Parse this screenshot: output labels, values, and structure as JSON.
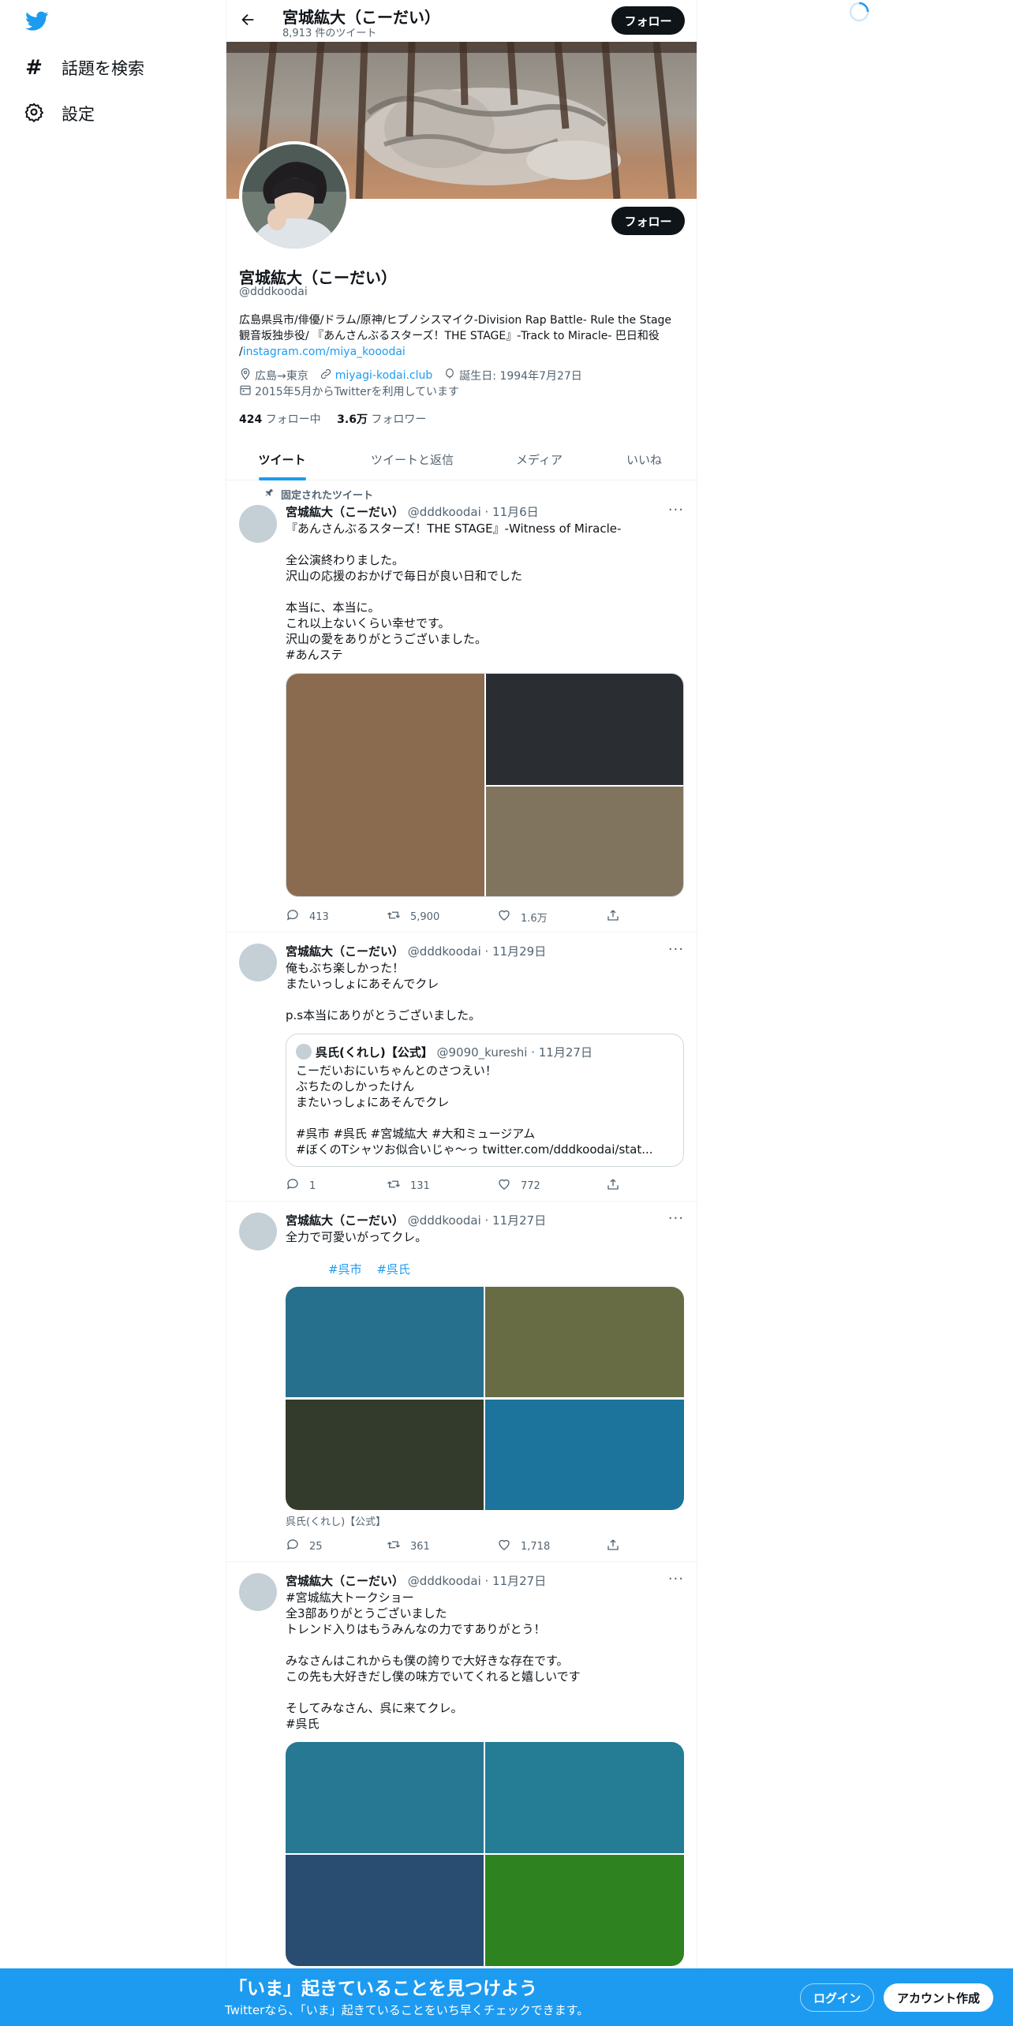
{
  "nav": {
    "items": [
      {
        "label": "話題を検索",
        "icon": "hashtag-icon"
      },
      {
        "label": "設定",
        "icon": "gear-icon"
      }
    ]
  },
  "header": {
    "title": "宮城紘大（こーだい）",
    "subtitle": "8,913 件のツイート",
    "follow_label": "フォロー"
  },
  "profile": {
    "name": "宮城紘大（こーだい）",
    "handle": "@dddkoodai",
    "follow_label": "フォロー",
    "bio_line1": "広島県呉市/俳優/ドラム/原神/ヒプノシスマイク-Division Rap Battle- Rule the Stage",
    "bio_line2": "観音坂独歩役/ 『あんさんぶるスターズ！THE STAGE』-Track to Miracle- 巴日和役",
    "bio_line3_prefix": "/",
    "bio_link": "instagram.com/miya_kooodai",
    "location": "広島→東京",
    "website": "miyagi-kodai.club",
    "birthday": "誕生日: 1994年7月27日",
    "joined": "2015年5月からTwitterを利用しています",
    "following_count": "424",
    "following_label": "フォロー中",
    "followers_count": "3.6万",
    "followers_label": "フォロワー"
  },
  "tabs": [
    "ツイート",
    "ツイートと返信",
    "メディア",
    "いいね"
  ],
  "tweets": [
    {
      "pinned_label": "固定されたツイート",
      "name": "宮城紘大（こーだい）",
      "meta": "@dddkoodai · 11月6日",
      "text": "『あんさんぶるスターズ！THE STAGE』-Witness of Miracle-\n\n全公演終わりました。\n沢山の応援のおかげで毎日が良い日和でした\n\n本当に、本当に。\nこれ以上ないくらい幸せです。\n沢山の愛をありがとうございました。",
      "hashtag": "#あんステ",
      "replies": "413",
      "retweets": "5,900",
      "likes": "1.6万",
      "colors": [
        "#8b6b50",
        "#2a2e33",
        "#81745f"
      ]
    },
    {
      "name": "宮城紘大（こーだい）",
      "meta": "@dddkoodai · 11月29日",
      "text": "俺もぶち楽しかった！\nまたいっしょにあそんでクレ\n\np.s本当にありがとうございました。",
      "quote": {
        "name": "呉氏(くれし)【公式】",
        "meta": "@9090_kureshi · 11月27日",
        "text": "こーだいおにいちゃんとのさつえい！\nぶちたのしかったけん\nまたいっしょにあそんでクレ\n\n#呉市 #呉氏 #宮城紘大 #大和ミュージアム\n#ぼくのTシャツお似合いじゃ〜っ twitter.com/dddkoodai/stat..."
      },
      "replies": "1",
      "retweets": "131",
      "likes": "772"
    },
    {
      "name": "宮城紘大（こーだい）",
      "meta": "@dddkoodai · 11月27日",
      "text": "全力で可愛いがってクレ。",
      "hashtags": [
        "#呉市",
        "#呉氏"
      ],
      "media_caption": "呉氏(くれし)【公式】",
      "replies": "25",
      "retweets": "361",
      "likes": "1,718",
      "colors": [
        "#26708d",
        "#686c44",
        "#333b2c",
        "#1c739b"
      ]
    },
    {
      "name": "宮城紘大（こーだい）",
      "meta": "@dddkoodai · 11月27日",
      "hashtag_top": "#宮城紘大トークショー",
      "text": "全3部ありがとうございました\nトレンド入りはもうみんなの力ですありがとう！\n\nみなさんはこれからも僕の誇りで大好きな存在です。\nこの先も大好きだし僕の味方でいてくれると嬉しいです\n\nそしてみなさん、呉に来てクレ。",
      "hashtag": "#呉氏",
      "colors": [
        "#267893",
        "#247c95",
        "#294d70",
        "#2e8320"
      ]
    }
  ],
  "bottom": {
    "headline": "「いま」起きていることを見つけよう",
    "subtext": "Twitterなら、「いま」起きていることをいち早くチェックできます。",
    "login": "ログイン",
    "signup": "アカウント作成"
  },
  "colors": {
    "accent": "#1d9bf0",
    "dark": "#0f1419",
    "muted": "#536471"
  }
}
